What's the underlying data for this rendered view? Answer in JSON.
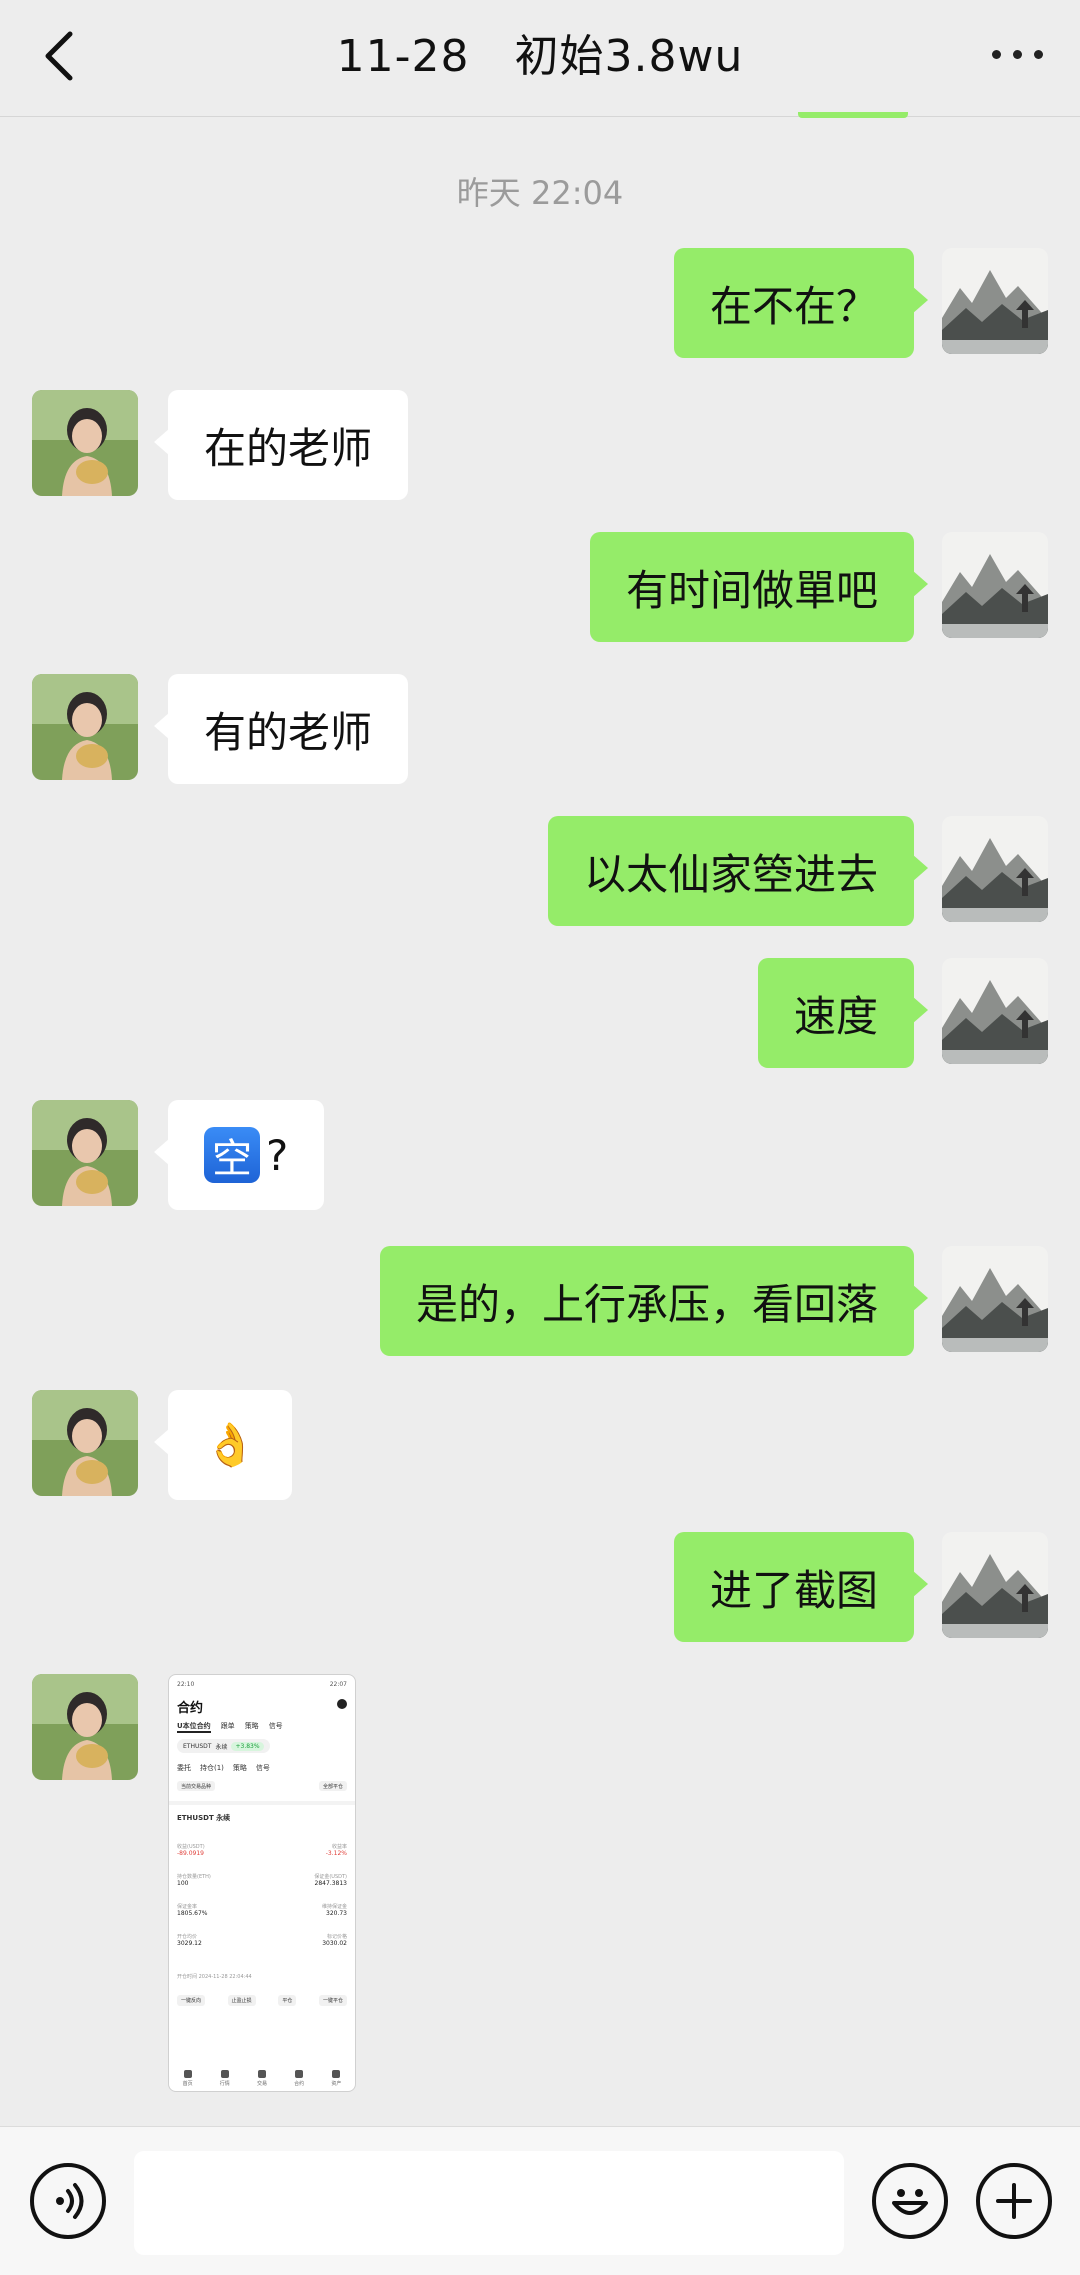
{
  "header": {
    "title": "11-28　初始3.8wu"
  },
  "chat": {
    "timestamp": "昨天 22:04",
    "messages": [
      {
        "side": "out",
        "text": "在不在？"
      },
      {
        "side": "in",
        "text": "在的老师"
      },
      {
        "side": "out",
        "text": "有时间做單吧"
      },
      {
        "side": "in",
        "text": "有的老师"
      },
      {
        "side": "out",
        "text": "以太仙家箜进去"
      },
      {
        "side": "out",
        "text": "速度"
      },
      {
        "side": "in",
        "badge": "空",
        "text": "?"
      },
      {
        "side": "out",
        "text": "是的，上行承压，看回落"
      },
      {
        "side": "in",
        "text": "👌"
      },
      {
        "side": "out",
        "text": "进了截图"
      },
      {
        "side": "in",
        "type": "image"
      }
    ]
  },
  "thumbnail": {
    "status_left": "22:10",
    "status_right": "22:07",
    "title": "合约",
    "tabs": [
      "U本位合约",
      "跟单",
      "策略",
      "信号"
    ],
    "pair": "ETHUSDT",
    "pair_type": "永续",
    "pair_change": "+3.83%",
    "subtabs": [
      "委托",
      "持仓(1)",
      "策略",
      "信号"
    ],
    "filter_btn": "当前交易品种",
    "close_all_btn": "全部平仓",
    "symbol": "ETHUSDT 永续",
    "rows": [
      {
        "l_label": "收益(USDT)",
        "l_val": "-89.0919",
        "r_label": "收益率",
        "r_val": "-3.12%",
        "red": true
      },
      {
        "l_label": "持仓数量(ETH)",
        "l_val": "100",
        "r_label": "保证金(USDT)",
        "r_val": "2847.3813",
        "red": false
      },
      {
        "l_label": "保证金率",
        "l_val": "1805.67%",
        "r_label": "维持保证金",
        "r_val": "320.73",
        "red": false
      },
      {
        "l_label": "开仓均价",
        "l_val": "3029.12",
        "r_label": "标记价格",
        "r_val": "3030.02",
        "red": false
      }
    ],
    "open_time": "开仓时间 2024-11-28 22:04:44",
    "actions": [
      "一键反向",
      "止盈止损",
      "平仓",
      "一键平仓"
    ],
    "nav": [
      "首页",
      "行情",
      "交易",
      "合约",
      "资产"
    ]
  },
  "input": {
    "placeholder": ""
  }
}
